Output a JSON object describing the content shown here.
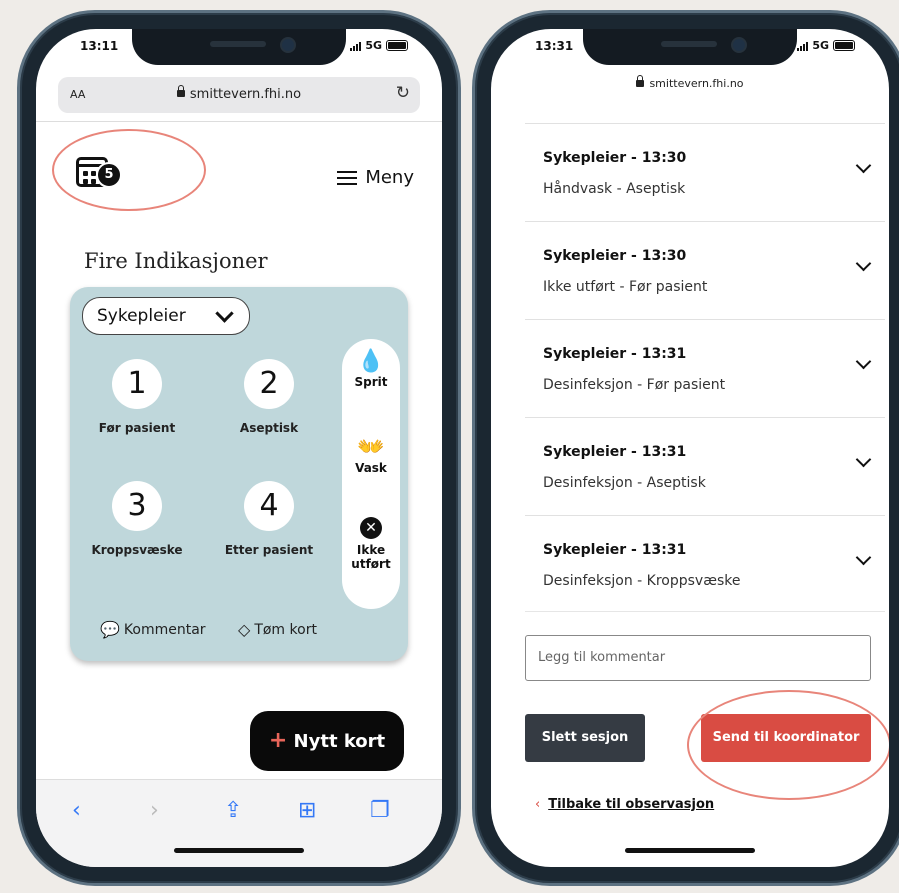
{
  "left_phone": {
    "status": {
      "time": "13:11",
      "network": "5G"
    },
    "address_bar": {
      "text_size": "AA",
      "url": "smittevern.fhi.no"
    },
    "header": {
      "badge_count": "5",
      "menu_label": "Meny"
    },
    "page_title": "Fire Indikasjoner",
    "role_select": {
      "value": "Sykepleier"
    },
    "indications": [
      {
        "number": "1",
        "label": "Før pasient"
      },
      {
        "number": "2",
        "label": "Aseptisk"
      },
      {
        "number": "3",
        "label": "Kroppsvæske"
      },
      {
        "number": "4",
        "label": "Etter pasient"
      }
    ],
    "actions": {
      "sprit": "Sprit",
      "vask": "Vask",
      "ikke_line1": "Ikke",
      "ikke_line2": "utført"
    },
    "card_footer": {
      "comment": "Kommentar",
      "clear": "Tøm kort"
    },
    "new_card_button": {
      "plus": "+",
      "label": "Nytt kort"
    }
  },
  "right_phone": {
    "status": {
      "time": "13:31",
      "network": "5G"
    },
    "url": "smittevern.fhi.no",
    "entries": [
      {
        "title": "Sykepleier - 13:30",
        "subtitle": "Håndvask - Aseptisk"
      },
      {
        "title": "Sykepleier - 13:30",
        "subtitle": "Ikke utført - Før pasient"
      },
      {
        "title": "Sykepleier - 13:31",
        "subtitle": "Desinfeksjon - Før pasient"
      },
      {
        "title": "Sykepleier - 13:31",
        "subtitle": "Desinfeksjon - Aseptisk"
      },
      {
        "title": "Sykepleier - 13:31",
        "subtitle": "Desinfeksjon - Kroppsvæske"
      }
    ],
    "comment_placeholder": "Legg til kommentar",
    "delete_button": "Slett sesjon",
    "send_button": "Send til koordinator",
    "back_link": "Tilbake til observasjon"
  },
  "colors": {
    "accent": "#d94c43",
    "card": "#bfd7db",
    "highlight": "#e8857a"
  }
}
